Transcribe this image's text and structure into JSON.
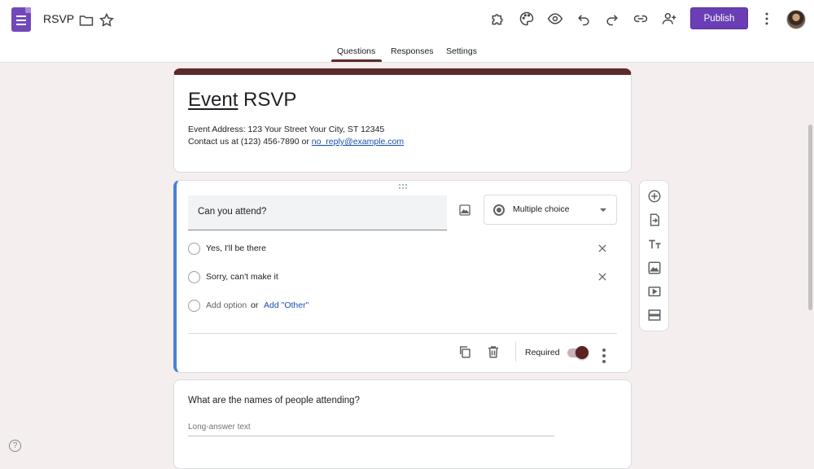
{
  "header": {
    "doc_title": "RSVP",
    "publish_label": "Publish",
    "icons": [
      "folder-icon",
      "star-icon",
      "puzzle-icon",
      "palette-icon",
      "eye-icon",
      "undo-icon",
      "redo-icon",
      "link-icon",
      "add-person-icon",
      "more-vert-icon"
    ]
  },
  "tabs": [
    {
      "label": "Questions",
      "active": true
    },
    {
      "label": "Responses",
      "active": false
    },
    {
      "label": "Settings",
      "active": false
    }
  ],
  "form": {
    "title_part1": "Event",
    "title_part2": " RSVP",
    "desc_line1": "Event Address: 123 Your Street Your City, ST 12345",
    "desc_line2_prefix": "Contact us at (123) 456-7890 or ",
    "desc_email": "no_reply@example.com"
  },
  "question1": {
    "text": "Can you attend?",
    "type": "Multiple choice",
    "options": [
      "Yes,  I'll be there",
      "Sorry, can't make it"
    ],
    "add_option": "Add option",
    "or": "or",
    "add_other": "Add \"Other\"",
    "required_label": "Required",
    "required": true
  },
  "question2": {
    "text": "What are the names of people attending?",
    "answer_hint": "Long-answer text"
  },
  "help": "?",
  "colors": {
    "accent": "#6a3fb5",
    "theme": "#5c2a2a",
    "active_border": "#4a7fd8",
    "background": "#f4efee"
  }
}
